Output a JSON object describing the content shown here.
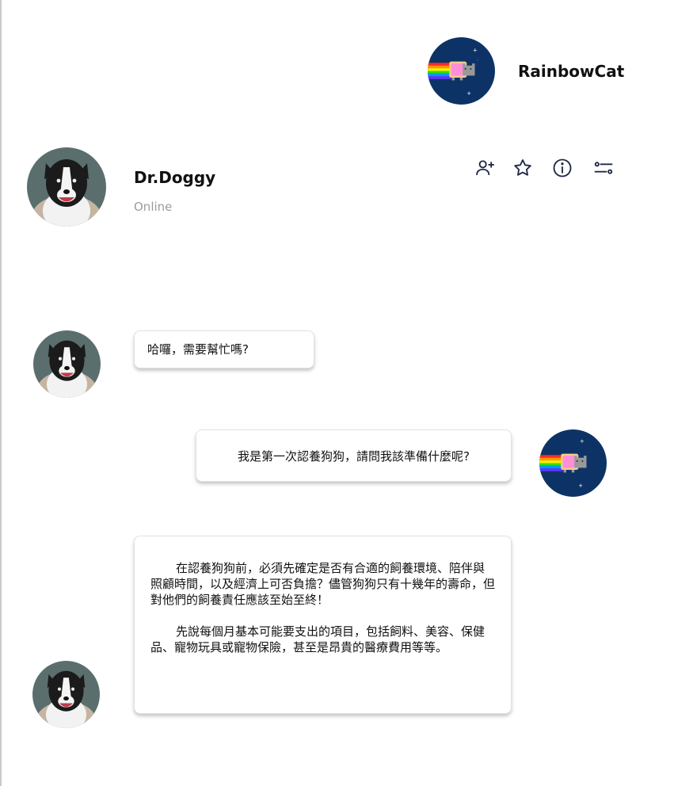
{
  "user": {
    "name": "RainbowCat",
    "avatar_icon": "nyan-cat-avatar"
  },
  "contact": {
    "name": "Dr.Doggy",
    "status": "Online",
    "avatar_icon": "dog-avatar"
  },
  "header_actions": [
    {
      "icon": "add-user-icon"
    },
    {
      "icon": "star-icon"
    },
    {
      "icon": "info-icon"
    },
    {
      "icon": "settings-sliders-icon"
    }
  ],
  "messages": [
    {
      "sender": "Dr.Doggy",
      "text": "哈囉，需要幫忙嗎?"
    },
    {
      "sender": "RainbowCat",
      "text": "我是第一次認養狗狗，請問我該準備什麼呢?"
    },
    {
      "sender": "Dr.Doggy",
      "paragraphs": [
        "在認養狗狗前，必須先確定是否有合適的飼養環境、陪伴與照顧時間，以及經濟上可否負擔？儘管狗狗只有十幾年的壽命，但對他們的飼養責任應該至始至終！",
        "先說每個月基本可能要支出的項目，包括飼料、美容、保健品、寵物玩具或寵物保險，甚至是昂貴的醫療費用等等。"
      ]
    }
  ],
  "colors": {
    "cat_bg": "#0d3366",
    "icon_stroke": "#1f2a44",
    "status_gray": "#9c9c9c"
  }
}
